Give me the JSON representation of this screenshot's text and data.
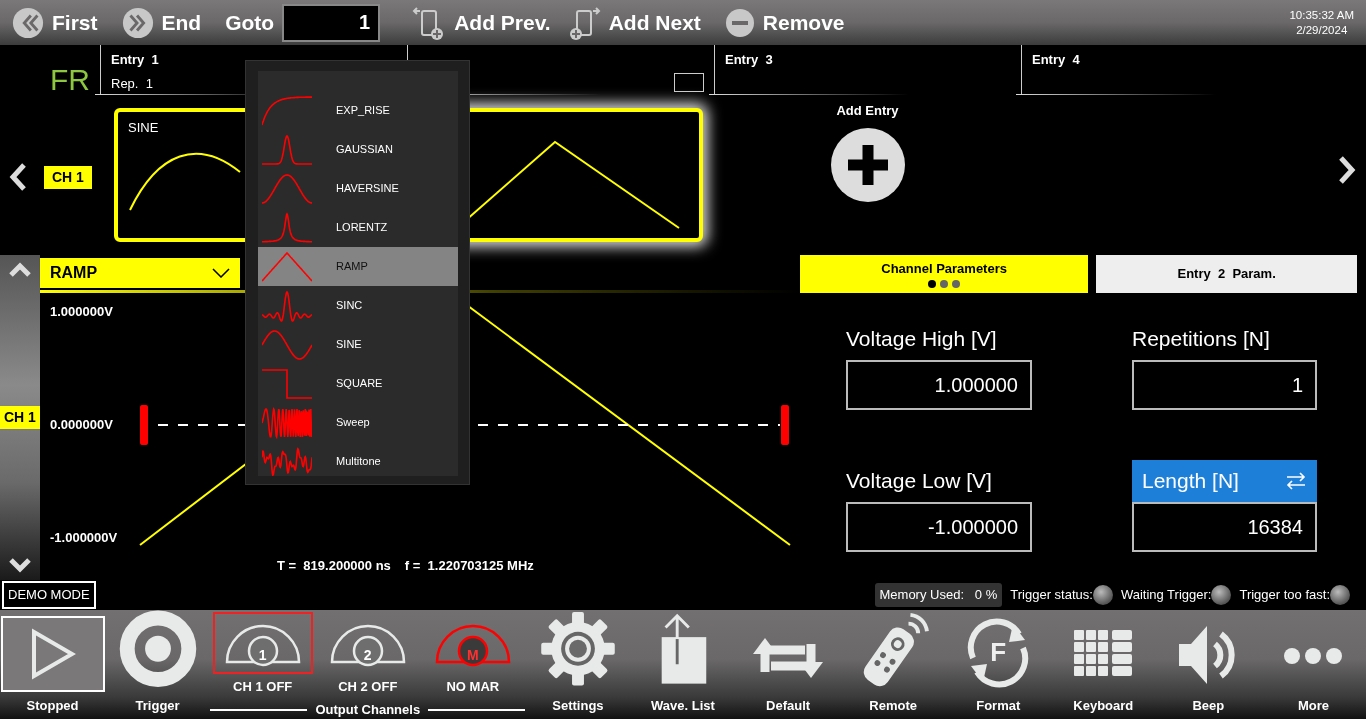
{
  "top_bar": {
    "first": "First",
    "end": "End",
    "goto_label": "Goto",
    "goto_value": "1",
    "add_prev": "Add Prev.",
    "add_next": "Add Next",
    "remove": "Remove",
    "time": "10:35:32 AM",
    "date": "2/29/2024"
  },
  "mode_badge": "FR",
  "channel_badge": "CH 1",
  "entries": [
    {
      "title": "Entry  1",
      "rep": "Rep.  1",
      "card": {
        "label": "SINE",
        "kind": "sine"
      },
      "selected": false
    },
    {
      "checkbox": {
        "checked": false
      },
      "card": {
        "kind": "ramp"
      },
      "selected": true
    },
    {
      "title": "Entry  3",
      "add_label": "Add Entry"
    },
    {
      "title": "Entry  4"
    }
  ],
  "waveform_select": {
    "value": "RAMP",
    "expanded": true,
    "options": [
      {
        "label": "EXP_RISE",
        "kind": "exp_rise",
        "selected": false
      },
      {
        "label": "GAUSSIAN",
        "kind": "gaussian",
        "selected": false
      },
      {
        "label": "HAVERSINE",
        "kind": "haversine",
        "selected": false
      },
      {
        "label": "LORENTZ",
        "kind": "lorentz",
        "selected": false
      },
      {
        "label": "RAMP",
        "kind": "ramp",
        "selected": true
      },
      {
        "label": "SINC",
        "kind": "sinc",
        "selected": false
      },
      {
        "label": "SINE",
        "kind": "sine",
        "selected": false
      },
      {
        "label": "SQUARE",
        "kind": "square",
        "selected": false
      },
      {
        "label": "Sweep",
        "kind": "sweep",
        "selected": false
      },
      {
        "label": "Multitone",
        "kind": "multitone",
        "selected": false
      }
    ]
  },
  "plot": {
    "channel_label": "CH 1",
    "y_labels": [
      "1.000000V",
      "0.000000V",
      "-1.000000V"
    ],
    "period": "T =  819.200000 ns",
    "frequency": "f =  1.220703125 MHz"
  },
  "param_tabs": [
    {
      "label": "Channel Parameters",
      "selected": true
    },
    {
      "label": "Entry  2  Param.",
      "selected": false
    }
  ],
  "params": [
    {
      "label": "Voltage High [V]",
      "value": "1.000000",
      "kind": "plain"
    },
    {
      "label": "Repetitions [N]",
      "value": "1",
      "kind": "plain"
    },
    {
      "label": "Voltage Low [V]",
      "value": "-1.000000",
      "kind": "plain"
    },
    {
      "label": "Length [N]",
      "value": "16384",
      "kind": "swap"
    }
  ],
  "status": {
    "demo": "DEMO MODE",
    "memory_label": "Memory Used:",
    "memory_value": "0 %",
    "indicators": [
      {
        "label": "Trigger status:",
        "on": false
      },
      {
        "label": "Waiting Trigger:",
        "on": false
      },
      {
        "label": "Trigger too fast:",
        "on": false
      }
    ]
  },
  "toolbar": {
    "before": [
      {
        "label": "Stopped",
        "kind": "play"
      },
      {
        "label": "Trigger",
        "kind": "trigger"
      }
    ],
    "output_channels": {
      "caption": "Output Channels",
      "items": [
        {
          "label": "CH 1 OFF",
          "kind": "channel",
          "icon_text": "1",
          "selected": true
        },
        {
          "label": "CH 2 OFF",
          "kind": "channel",
          "icon_text": "2",
          "selected": false
        },
        {
          "label": "NO MAR",
          "kind": "marker",
          "icon_text": "M",
          "selected": false
        }
      ]
    },
    "after": [
      {
        "label": "Settings",
        "kind": "gear"
      },
      {
        "label": "Wave. List",
        "kind": "upload"
      },
      {
        "label": "Default",
        "kind": "repeat"
      },
      {
        "label": "Remote",
        "kind": "remote"
      },
      {
        "label": "Format",
        "kind": "format",
        "icon_text": "F"
      },
      {
        "label": "Keyboard",
        "kind": "keypad"
      },
      {
        "label": "Beep",
        "kind": "speaker"
      },
      {
        "label": "More",
        "kind": "more"
      }
    ]
  }
}
